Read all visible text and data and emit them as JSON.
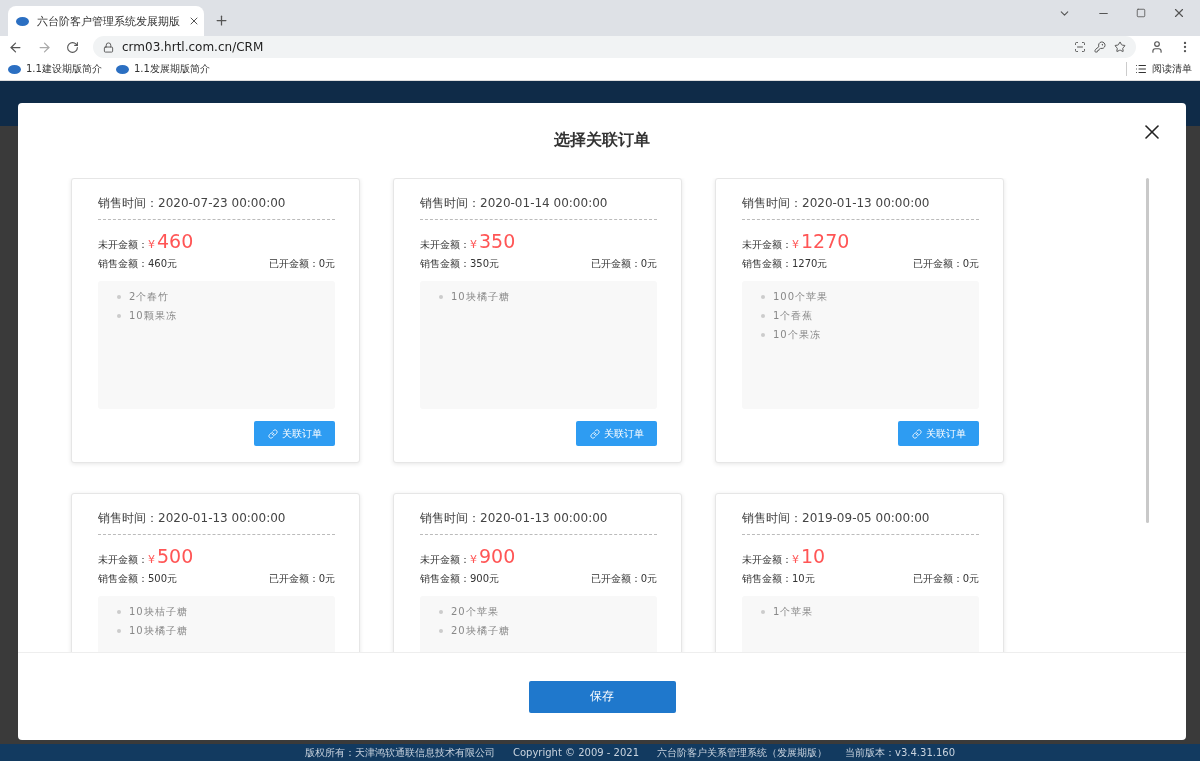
{
  "browser": {
    "tab_title": "六台阶客户管理系统发展期版",
    "url": "crm03.hrtl.com.cn/CRM",
    "bookmarks": [
      "1.1建设期版简介",
      "1.1发展期版简介"
    ],
    "reading_list": "阅读清单"
  },
  "dialog": {
    "title": "选择关联订单",
    "orders": [
      {
        "time_label": "销售时间：",
        "time": "2020-07-23 00:00:00",
        "unpaid_label": "未开金额：",
        "currency": "¥",
        "unpaid": "460",
        "sales": "销售金额：460元",
        "invoiced": "已开金额：0元",
        "items": [
          "2个春竹",
          "10颗果冻"
        ],
        "button": "关联订单"
      },
      {
        "time_label": "销售时间：",
        "time": "2020-01-14 00:00:00",
        "unpaid_label": "未开金额：",
        "currency": "¥",
        "unpaid": "350",
        "sales": "销售金额：350元",
        "invoiced": "已开金额：0元",
        "items": [
          "10块橘子糖"
        ],
        "button": "关联订单"
      },
      {
        "time_label": "销售时间：",
        "time": "2020-01-13 00:00:00",
        "unpaid_label": "未开金额：",
        "currency": "¥",
        "unpaid": "1270",
        "sales": "销售金额：1270元",
        "invoiced": "已开金额：0元",
        "items": [
          "100个苹果",
          "1个香蕉",
          "10个果冻"
        ],
        "button": "关联订单"
      },
      {
        "time_label": "销售时间：",
        "time": "2020-01-13 00:00:00",
        "unpaid_label": "未开金额：",
        "currency": "¥",
        "unpaid": "500",
        "sales": "销售金额：500元",
        "invoiced": "已开金额：0元",
        "items": [
          "10块桔子糖",
          "10块橘子糖"
        ]
      },
      {
        "time_label": "销售时间：",
        "time": "2020-01-13 00:00:00",
        "unpaid_label": "未开金额：",
        "currency": "¥",
        "unpaid": "900",
        "sales": "销售金额：900元",
        "invoiced": "已开金额：0元",
        "items": [
          "20个苹果",
          "20块橘子糖"
        ]
      },
      {
        "time_label": "销售时间：",
        "time": "2019-09-05 00:00:00",
        "unpaid_label": "未开金额：",
        "currency": "¥",
        "unpaid": "10",
        "sales": "销售金额：10元",
        "invoiced": "已开金额：0元",
        "items": [
          "1个苹果"
        ]
      }
    ],
    "save_button": "保存"
  },
  "footer": [
    "版权所有：天津鸿软通联信息技术有限公司",
    "Copyright © 2009 - 2021",
    "六台阶客户关系管理系统（发展期版）",
    "当前版本：v3.4.31.160"
  ]
}
